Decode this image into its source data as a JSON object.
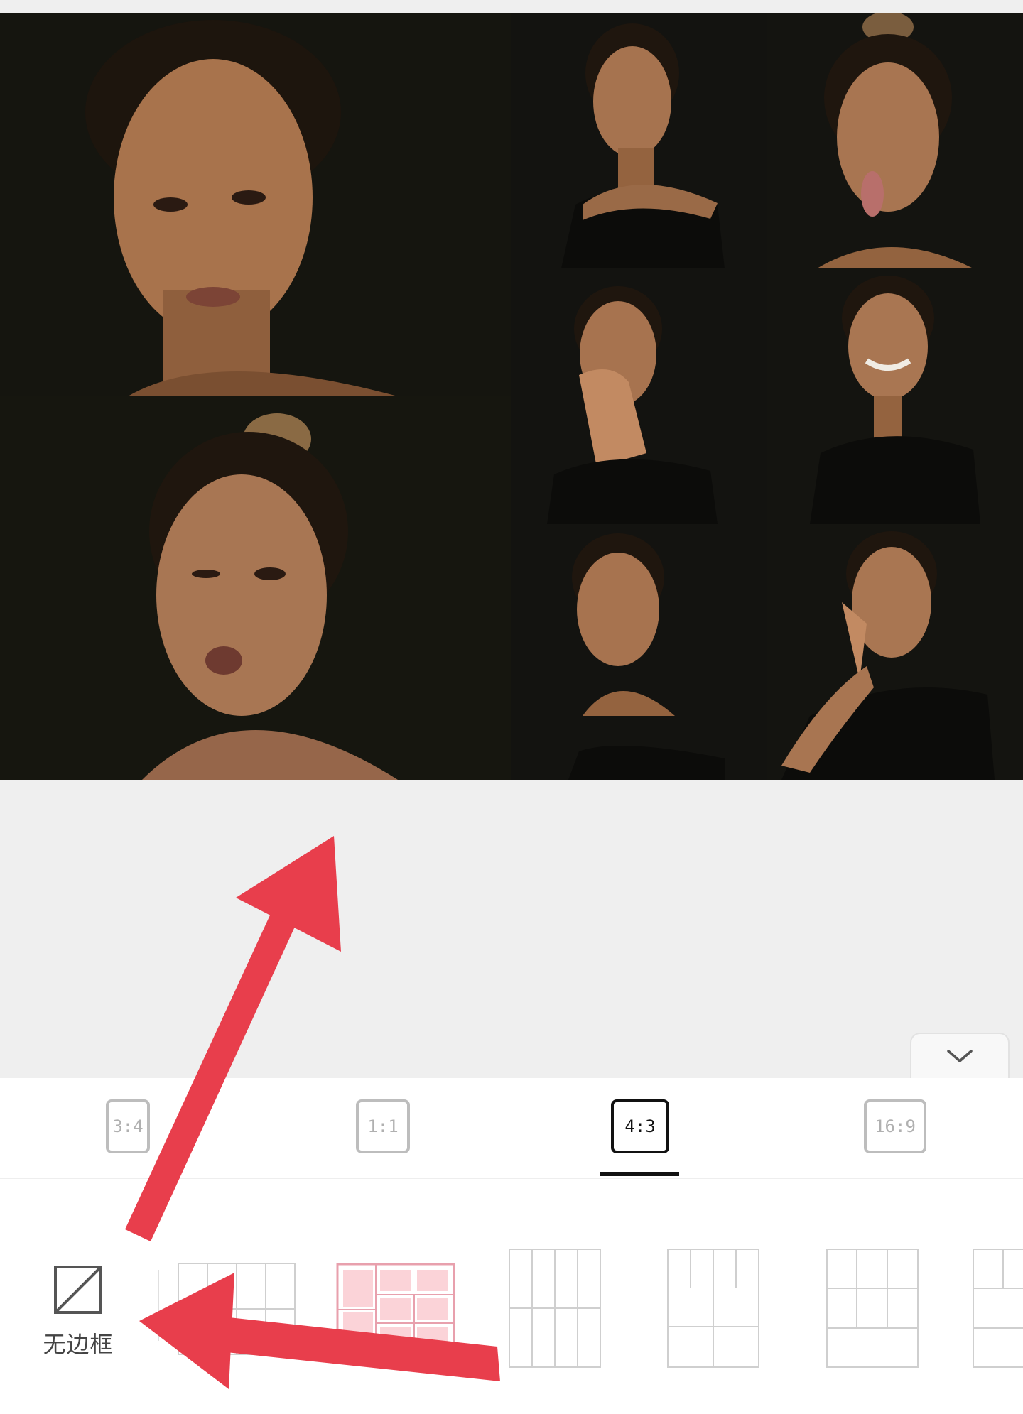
{
  "collage": {
    "photos": [
      {
        "desc": "pouting-face-portrait"
      },
      {
        "desc": "glance-over-shoulder-portrait"
      },
      {
        "desc": "tongue-out-portrait"
      },
      {
        "desc": "wink-kiss-portrait"
      },
      {
        "desc": "hand-over-mouth-portrait"
      },
      {
        "desc": "wink-smile-portrait"
      },
      {
        "desc": "squint-face-portrait"
      },
      {
        "desc": "surprised-hand-on-cheek-portrait"
      }
    ]
  },
  "collapse_button": {
    "icon": "chevron-down-icon"
  },
  "ratio_tabs": {
    "items": [
      {
        "label": "3:4"
      },
      {
        "label": "1:1"
      },
      {
        "label": "4:3",
        "active": true
      },
      {
        "label": "16:9"
      }
    ]
  },
  "layouts": {
    "no_border_label": "无边框",
    "no_border_icon": "no-border-icon",
    "selected_index": 1,
    "accent_color": "#e8a0ad"
  },
  "annotations": {
    "arrow_color": "#e83e4c"
  }
}
